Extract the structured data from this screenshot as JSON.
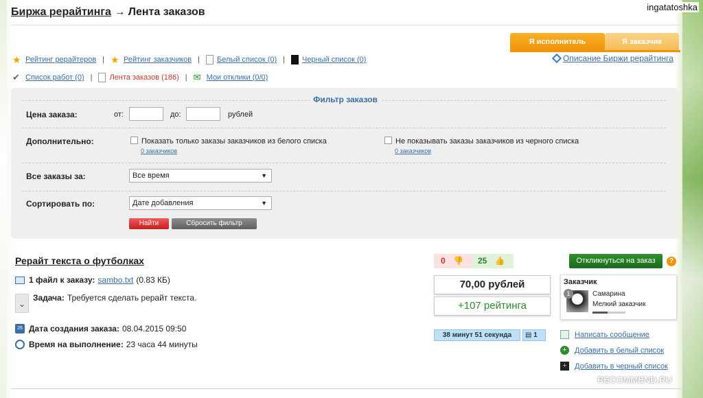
{
  "user": {
    "name": "ingatatoshka"
  },
  "breadcrumb": {
    "root": "Биржа рерайтинга",
    "arrow": "→",
    "current": "Лента заказов"
  },
  "role_tabs": {
    "executor": "Я исполнитель",
    "customer": "Я заказчик"
  },
  "nav_row1": [
    {
      "label": "Рейтинг рерайтеров",
      "icon": "star-icon"
    },
    {
      "label": "Рейтинг заказчиков",
      "icon": "star-icon"
    },
    {
      "label": "Белый список (0)",
      "icon": "white-list-icon"
    },
    {
      "label": "Черный список (0)",
      "icon": "black-list-icon"
    }
  ],
  "nav_row2": [
    {
      "label": "Список работ (0)",
      "icon": "checklist-icon"
    },
    {
      "label": "Лента заказов (186)",
      "icon": "document-icon"
    },
    {
      "label": "Мои отклики (0/0)",
      "icon": "responses-icon"
    }
  ],
  "nav_sep": "|",
  "description_link": "Описание Биржи рерайтинга",
  "filter": {
    "title": "Фильтр заказов",
    "price_label": "Цена заказа:",
    "from_label": "от:",
    "to_label": "до:",
    "currency": "рублей",
    "extra_label": "Дополнительно:",
    "whitelist_only": "Показать только заказы заказчиков из белого списка",
    "whitelist_count": "0 заказчиков",
    "hide_blacklist": "Не показывать заказы заказчиков из черного списка",
    "blacklist_count": "0 заказчиков",
    "period_label": "Все заказы за:",
    "period_value": "Все время",
    "sort_label": "Сортировать по:",
    "sort_value": "Дате добавления",
    "find_button": "Найти",
    "reset_button": "Сбросить фильтр"
  },
  "order": {
    "title": "Рерайт текста о футболках",
    "files_label": "1 файл к заказу:",
    "file_name": "sambo.txt",
    "file_size": "(0.83 КБ)",
    "task_label": "Задача:",
    "task_text": "Требуется сделать рерайт текста.",
    "created_label": "Дата создания заказа:",
    "created_value": "08.04.2015 09:50",
    "duration_label": "Время на выполнение:",
    "duration_value": "23 часа 44 минуты",
    "votes_down": "0",
    "votes_up": "25",
    "price": "70,00 рублей",
    "rating_bonus": "+107 рейтинга",
    "time_left": "38 минут 51 секунда",
    "responses_count": "1",
    "respond_button": "Откликнуться на заказ",
    "help": "?",
    "calendar_day": "26"
  },
  "customer": {
    "title": "Заказчик",
    "level": "1",
    "name": "Самарина",
    "type": "Мелкий заказчик",
    "level_progress": 0.45
  },
  "actions": [
    {
      "label": "Написать сообщение",
      "icon": "message-icon"
    },
    {
      "label": "Добавить в белый список",
      "icon": "add-white-list-icon"
    },
    {
      "label": "Добавить в черный список",
      "icon": "add-black-list-icon"
    }
  ],
  "watermark": "RECOMMEND.RU",
  "colors": {
    "link": "#3a6ea5",
    "accent_orange": "#f19306",
    "find_red": "#c81e1e",
    "respond_green": "#1d6b1d"
  }
}
